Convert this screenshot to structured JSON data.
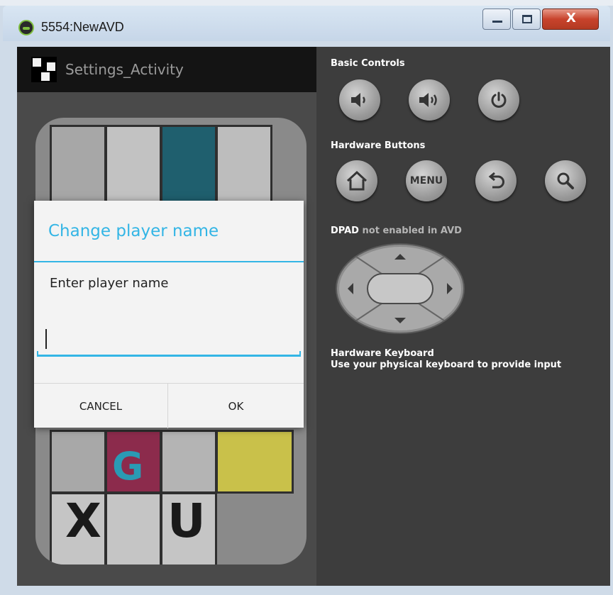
{
  "window": {
    "title": "5554:NewAVD",
    "controls": {
      "close": "X"
    }
  },
  "android": {
    "actionbar_title": "Settings_Activity",
    "dialog": {
      "title": "Change player name",
      "message": "Enter player name",
      "input_value": "",
      "cancel_label": "CANCEL",
      "ok_label": "OK"
    },
    "background_letters": [
      "X",
      "U",
      "G"
    ]
  },
  "controls": {
    "basic_controls_label": "Basic Controls",
    "hardware_buttons_label": "Hardware Buttons",
    "menu_label": "MENU",
    "dpad_label_bold": "DPAD",
    "dpad_label_rest": "not enabled in AVD",
    "keyboard_title": "Hardware Keyboard",
    "keyboard_desc": "Use your physical keyboard to provide input"
  },
  "colors": {
    "accent": "#33b5e5",
    "panel_bg": "#3d3d3d",
    "actionbar_bg": "#141414"
  }
}
